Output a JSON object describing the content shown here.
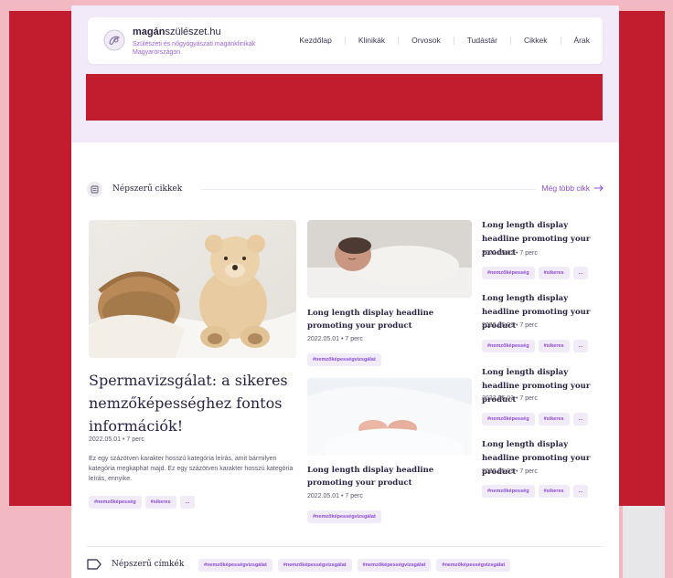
{
  "site": {
    "brand_bold": "magán",
    "brand_rest": "szülészet.hu",
    "tagline": "Szülészeti és nőgyógyászati magánklinikák Magyarországon"
  },
  "nav": {
    "items": [
      {
        "label": "Kezdőlap"
      },
      {
        "label": "Klinikák"
      },
      {
        "label": "Orvosok"
      },
      {
        "label": "Tudástár"
      },
      {
        "label": "Cikkek"
      },
      {
        "label": "Árak"
      }
    ]
  },
  "popular": {
    "title": "Népszerű cikkek",
    "more_label": "Még több cikk"
  },
  "featured": {
    "title": "Spermavizsgálat: a sikeres nemzőképességhez fontos információk!",
    "date": "2022.05.01",
    "read_time": "7 perc",
    "excerpt": "Ez egy százötven karakter hosszú kategória leírás, amit bármilyen kategória megkaphat majd. Ez egy százötven karakter hosszú kategória leírás, ennyike.",
    "tags": [
      "#nemzőképesség",
      "#sikeres",
      "..."
    ]
  },
  "middle_cards": [
    {
      "title": "Long length display headline promoting your product",
      "date": "2022.05.01",
      "read_time": "7 perc",
      "tags": [
        "#nemzőképességvizsgálat"
      ]
    },
    {
      "title": "Long length display headline promoting your product",
      "date": "2022.05.01",
      "read_time": "7 perc",
      "tags": [
        "#nemzőképességvizsgálat"
      ]
    }
  ],
  "side_cards": [
    {
      "title": "Long length display headline promoting your product",
      "date": "2022.05.01",
      "read_time": "7 perc",
      "tags": [
        "#nemzőképesség",
        "#sikeres",
        "..."
      ]
    },
    {
      "title": "Long length display headline promoting your product",
      "date": "2022.05.01",
      "read_time": "7 perc",
      "tags": [
        "#nemzőképesség",
        "#sikeres",
        "..."
      ]
    },
    {
      "title": "Long length display headline promoting your product",
      "date": "2022.05.01",
      "read_time": "7 perc",
      "tags": [
        "#nemzőképesség",
        "#sikeres",
        "..."
      ]
    },
    {
      "title": "Long length display headline promoting your product",
      "date": "2022.05.01",
      "read_time": "7 perc",
      "tags": [
        "#nemzőképesség",
        "#sikeres",
        "..."
      ]
    }
  ],
  "popular_tags": {
    "title": "Népszerű címkék",
    "tags": [
      "#nemzőképességvizsgálat",
      "#nemzőképességvizsgálat",
      "#nemzőképességvizsgálat",
      "#nemzőképességvizsgálat"
    ]
  },
  "icons": {
    "logo": "stork-logo-icon",
    "article": "article-icon",
    "arrow": "arrow-right-icon",
    "tag": "tag-icon"
  },
  "colors": {
    "accent": "#8a4bd1",
    "overlay_red": "#c11d2e",
    "hero_bg": "#f3eaf9",
    "text_dark": "#2b2342"
  }
}
